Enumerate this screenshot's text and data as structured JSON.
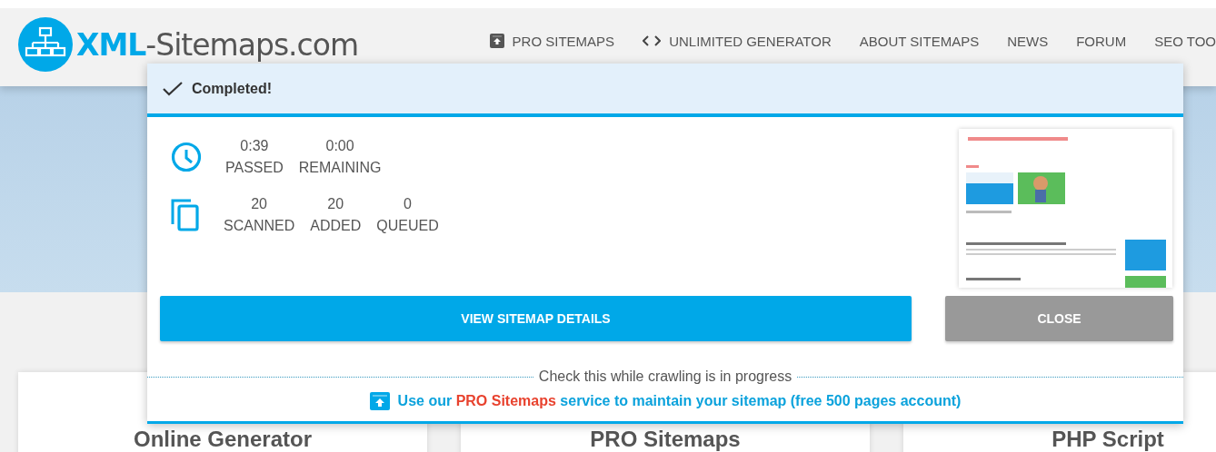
{
  "logo": {
    "strong": "XML",
    "rest": "-Sitemaps.com"
  },
  "nav": [
    {
      "label": "PRO SITEMAPS",
      "kind": "pro"
    },
    {
      "label": "UNLIMITED GENERATOR",
      "kind": "code"
    },
    {
      "label": "ABOUT SITEMAPS",
      "kind": "plain"
    },
    {
      "label": "NEWS",
      "kind": "plain"
    },
    {
      "label": "FORUM",
      "kind": "plain"
    },
    {
      "label": "SEO TOO",
      "kind": "plain"
    }
  ],
  "cards": [
    "Online Generator",
    "PRO Sitemaps",
    "PHP Script"
  ],
  "dialog": {
    "status": "Completed!",
    "stats": [
      {
        "kind": "clock",
        "items": [
          {
            "value": "0:39",
            "label": "PASSED"
          },
          {
            "value": "0:00",
            "label": "REMAINING"
          }
        ]
      },
      {
        "kind": "pages",
        "items": [
          {
            "value": "20",
            "label": "SCANNED"
          },
          {
            "value": "20",
            "label": "ADDED"
          },
          {
            "value": "0",
            "label": "QUEUED"
          }
        ]
      }
    ],
    "buttons": [
      {
        "label": "VIEW SITEMAP DETAILS",
        "kind": "primary"
      },
      {
        "label": "CLOSE",
        "kind": "secondary"
      }
    ],
    "hint": "Check this while crawling is in progress",
    "promo": [
      {
        "text": "Use our ",
        "highlight": false
      },
      {
        "text": "PRO Sitemaps",
        "highlight": true
      },
      {
        "text": " service to maintain your sitemap (free 500 pages account)",
        "highlight": false
      }
    ]
  }
}
